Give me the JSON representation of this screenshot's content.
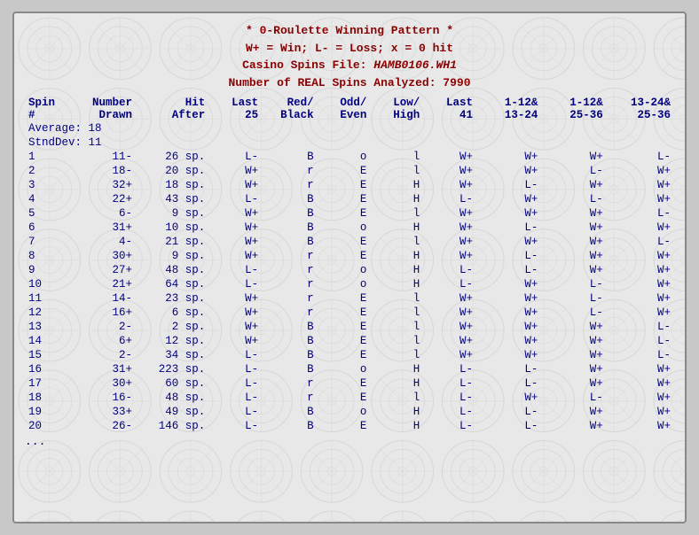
{
  "header": {
    "line1": "* 0-Roulette Winning Pattern *",
    "line2": "W+ = Win; L- = Loss; x = 0 hit",
    "line3_prefix": "Casino Spins File: ",
    "line3_filename": "HAMB0106.WH1",
    "line4": "Number of REAL Spins Analyzed: 7990"
  },
  "column_headers": {
    "row1": [
      "Spin",
      "Number",
      "Hit",
      "Last",
      "Red/",
      "Odd/",
      "Low/",
      "Last",
      "1-12&",
      "1-12&",
      "13-24&"
    ],
    "row2": [
      "#",
      "Drawn",
      "After",
      "25",
      "Black",
      "Even",
      "High",
      "41",
      "13-24",
      "25-36",
      "25-36"
    ]
  },
  "average": {
    "label": "Average:",
    "value": "18"
  },
  "stddev": {
    "label": "StndDev:",
    "value": "11"
  },
  "rows": [
    {
      "spin": "1",
      "number": "11-",
      "hit": "26",
      "unit": "sp.",
      "last25": "L-",
      "rb": "B",
      "oe": "o",
      "lh": "l",
      "last41": "W+",
      "c1": "W+",
      "c2": "W+",
      "c3": "L-"
    },
    {
      "spin": "2",
      "number": "18-",
      "hit": "20",
      "unit": "sp.",
      "last25": "W+",
      "rb": "r",
      "oe": "E",
      "lh": "l",
      "last41": "W+",
      "c1": "W+",
      "c2": "L-",
      "c3": "W+"
    },
    {
      "spin": "3",
      "number": "32+",
      "hit": "18",
      "unit": "sp.",
      "last25": "W+",
      "rb": "r",
      "oe": "E",
      "lh": "H",
      "last41": "W+",
      "c1": "L-",
      "c2": "W+",
      "c3": "W+"
    },
    {
      "spin": "4",
      "number": "22+",
      "hit": "43",
      "unit": "sp.",
      "last25": "L-",
      "rb": "B",
      "oe": "E",
      "lh": "H",
      "last41": "L-",
      "c1": "W+",
      "c2": "L-",
      "c3": "W+"
    },
    {
      "spin": "5",
      "number": "6-",
      "hit": "9",
      "unit": "sp.",
      "last25": "W+",
      "rb": "B",
      "oe": "E",
      "lh": "l",
      "last41": "W+",
      "c1": "W+",
      "c2": "W+",
      "c3": "L-"
    },
    {
      "spin": "6",
      "number": "31+",
      "hit": "10",
      "unit": "sp.",
      "last25": "W+",
      "rb": "B",
      "oe": "o",
      "lh": "H",
      "last41": "W+",
      "c1": "L-",
      "c2": "W+",
      "c3": "W+"
    },
    {
      "spin": "7",
      "number": "4-",
      "hit": "21",
      "unit": "sp.",
      "last25": "W+",
      "rb": "B",
      "oe": "E",
      "lh": "l",
      "last41": "W+",
      "c1": "W+",
      "c2": "W+",
      "c3": "L-"
    },
    {
      "spin": "8",
      "number": "30+",
      "hit": "9",
      "unit": "sp.",
      "last25": "W+",
      "rb": "r",
      "oe": "E",
      "lh": "H",
      "last41": "W+",
      "c1": "L-",
      "c2": "W+",
      "c3": "W+"
    },
    {
      "spin": "9",
      "number": "27+",
      "hit": "48",
      "unit": "sp.",
      "last25": "L-",
      "rb": "r",
      "oe": "o",
      "lh": "H",
      "last41": "L-",
      "c1": "L-",
      "c2": "W+",
      "c3": "W+"
    },
    {
      "spin": "10",
      "number": "21+",
      "hit": "64",
      "unit": "sp.",
      "last25": "L-",
      "rb": "r",
      "oe": "o",
      "lh": "H",
      "last41": "L-",
      "c1": "W+",
      "c2": "L-",
      "c3": "W+"
    },
    {
      "spin": "11",
      "number": "14-",
      "hit": "23",
      "unit": "sp.",
      "last25": "W+",
      "rb": "r",
      "oe": "E",
      "lh": "l",
      "last41": "W+",
      "c1": "W+",
      "c2": "L-",
      "c3": "W+"
    },
    {
      "spin": "12",
      "number": "16+",
      "hit": "6",
      "unit": "sp.",
      "last25": "W+",
      "rb": "r",
      "oe": "E",
      "lh": "l",
      "last41": "W+",
      "c1": "W+",
      "c2": "L-",
      "c3": "W+"
    },
    {
      "spin": "13",
      "number": "2-",
      "hit": "2",
      "unit": "sp.",
      "last25": "W+",
      "rb": "B",
      "oe": "E",
      "lh": "l",
      "last41": "W+",
      "c1": "W+",
      "c2": "W+",
      "c3": "L-"
    },
    {
      "spin": "14",
      "number": "6+",
      "hit": "12",
      "unit": "sp.",
      "last25": "W+",
      "rb": "B",
      "oe": "E",
      "lh": "l",
      "last41": "W+",
      "c1": "W+",
      "c2": "W+",
      "c3": "L-"
    },
    {
      "spin": "15",
      "number": "2-",
      "hit": "34",
      "unit": "sp.",
      "last25": "L-",
      "rb": "B",
      "oe": "E",
      "lh": "l",
      "last41": "W+",
      "c1": "W+",
      "c2": "W+",
      "c3": "L-"
    },
    {
      "spin": "16",
      "number": "31+",
      "hit": "223",
      "unit": "sp.",
      "last25": "L-",
      "rb": "B",
      "oe": "o",
      "lh": "H",
      "last41": "L-",
      "c1": "L-",
      "c2": "W+",
      "c3": "W+"
    },
    {
      "spin": "17",
      "number": "30+",
      "hit": "60",
      "unit": "sp.",
      "last25": "L-",
      "rb": "r",
      "oe": "E",
      "lh": "H",
      "last41": "L-",
      "c1": "L-",
      "c2": "W+",
      "c3": "W+"
    },
    {
      "spin": "18",
      "number": "16-",
      "hit": "48",
      "unit": "sp.",
      "last25": "L-",
      "rb": "r",
      "oe": "E",
      "lh": "l",
      "last41": "L-",
      "c1": "W+",
      "c2": "L-",
      "c3": "W+"
    },
    {
      "spin": "19",
      "number": "33+",
      "hit": "49",
      "unit": "sp.",
      "last25": "L-",
      "rb": "B",
      "oe": "o",
      "lh": "H",
      "last41": "L-",
      "c1": "L-",
      "c2": "W+",
      "c3": "W+"
    },
    {
      "spin": "20",
      "number": "26-",
      "hit": "146",
      "unit": "sp.",
      "last25": "L-",
      "rb": "B",
      "oe": "E",
      "lh": "H",
      "last41": "L-",
      "c1": "L-",
      "c2": "W+",
      "c3": "W+"
    }
  ],
  "footer": "..."
}
